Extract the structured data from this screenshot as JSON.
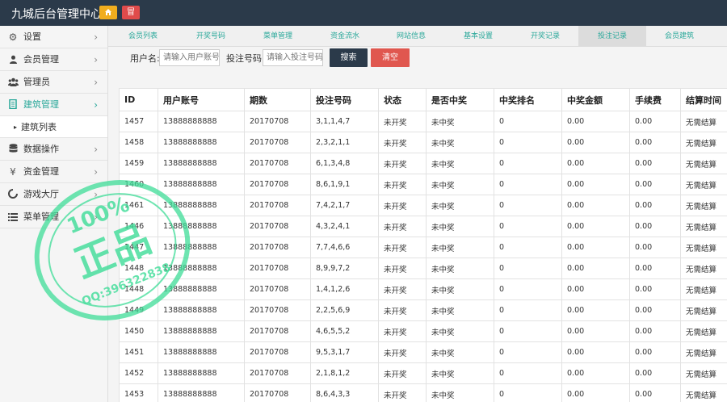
{
  "app": {
    "title": "九城后台管理中心",
    "home_icon": "home-icon",
    "exit_label": "冒"
  },
  "sidebar": {
    "items": [
      {
        "label": "设置",
        "icon": "gear-icon"
      },
      {
        "label": "会员管理",
        "icon": "user-icon"
      },
      {
        "label": "管理员",
        "icon": "users-icon"
      },
      {
        "label": "建筑管理",
        "icon": "book-icon",
        "active": true
      },
      {
        "label": "数据操作",
        "icon": "database-icon"
      },
      {
        "label": "资金管理",
        "icon": "yen-icon"
      },
      {
        "label": "游戏大厅",
        "icon": "circle-icon"
      },
      {
        "label": "菜单管理",
        "icon": "list-icon"
      }
    ],
    "sub_item": "建筑列表"
  },
  "tabs": [
    "会员列表",
    "开奖号码",
    "菜单管理",
    "资金流水",
    "网站信息",
    "基本设置",
    "开奖记录",
    "投注记录",
    "会员建筑"
  ],
  "filter": {
    "user_label": "用户名:",
    "user_placeholder": "请输入用户账号",
    "bet_label": "投注号码:",
    "bet_placeholder": "请输入投注号码",
    "search_label": "搜索",
    "clear_label": "清空"
  },
  "table": {
    "headers": [
      "ID",
      "用户账号",
      "期数",
      "投注号码",
      "状态",
      "是否中奖",
      "中奖排名",
      "中奖金额",
      "手续费",
      "结算时间"
    ],
    "rows": [
      [
        "1457",
        "13888888888",
        "20170708",
        "3,1,1,4,7",
        "未开奖",
        "未中奖",
        "0",
        "0.00",
        "0.00",
        "无需结算"
      ],
      [
        "1458",
        "13888888888",
        "20170708",
        "2,3,2,1,1",
        "未开奖",
        "未中奖",
        "0",
        "0.00",
        "0.00",
        "无需结算"
      ],
      [
        "1459",
        "13888888888",
        "20170708",
        "6,1,3,4,8",
        "未开奖",
        "未中奖",
        "0",
        "0.00",
        "0.00",
        "无需结算"
      ],
      [
        "1460",
        "13888888888",
        "20170708",
        "8,6,1,9,1",
        "未开奖",
        "未中奖",
        "0",
        "0.00",
        "0.00",
        "无需结算"
      ],
      [
        "1461",
        "13888888888",
        "20170708",
        "7,4,2,1,7",
        "未开奖",
        "未中奖",
        "0",
        "0.00",
        "0.00",
        "无需结算"
      ],
      [
        "1446",
        "13888888888",
        "20170708",
        "4,3,2,4,1",
        "未开奖",
        "未中奖",
        "0",
        "0.00",
        "0.00",
        "无需结算"
      ],
      [
        "1447",
        "13888888888",
        "20170708",
        "7,7,4,6,6",
        "未开奖",
        "未中奖",
        "0",
        "0.00",
        "0.00",
        "无需结算"
      ],
      [
        "1448",
        "13888888888",
        "20170708",
        "8,9,9,7,2",
        "未开奖",
        "未中奖",
        "0",
        "0.00",
        "0.00",
        "无需结算"
      ],
      [
        "1448",
        "13888888888",
        "20170708",
        "1,4,1,2,6",
        "未开奖",
        "未中奖",
        "0",
        "0.00",
        "0.00",
        "无需结算"
      ],
      [
        "1449",
        "13888888888",
        "20170708",
        "2,2,5,6,9",
        "未开奖",
        "未中奖",
        "0",
        "0.00",
        "0.00",
        "无需结算"
      ],
      [
        "1450",
        "13888888888",
        "20170708",
        "4,6,5,5,2",
        "未开奖",
        "未中奖",
        "0",
        "0.00",
        "0.00",
        "无需结算"
      ],
      [
        "1451",
        "13888888888",
        "20170708",
        "9,5,3,1,7",
        "未开奖",
        "未中奖",
        "0",
        "0.00",
        "0.00",
        "无需结算"
      ],
      [
        "1452",
        "13888888888",
        "20170708",
        "2,1,8,1,2",
        "未开奖",
        "未中奖",
        "0",
        "0.00",
        "0.00",
        "无需结算"
      ],
      [
        "1453",
        "13888888888",
        "20170708",
        "8,6,4,3,3",
        "未开奖",
        "未中奖",
        "0",
        "0.00",
        "0.00",
        "无需结算"
      ]
    ]
  },
  "watermark": {
    "top_text": "100%",
    "main_text": "正品",
    "qq_text": "QQ:396322838"
  },
  "colors": {
    "topbar": "#2b3a4a",
    "accent": "#2aa89a",
    "home_button": "#f0ad1e",
    "exit_button": "#e04b4b",
    "clear_button": "#e0574f",
    "watermark": "#3ddc97"
  }
}
